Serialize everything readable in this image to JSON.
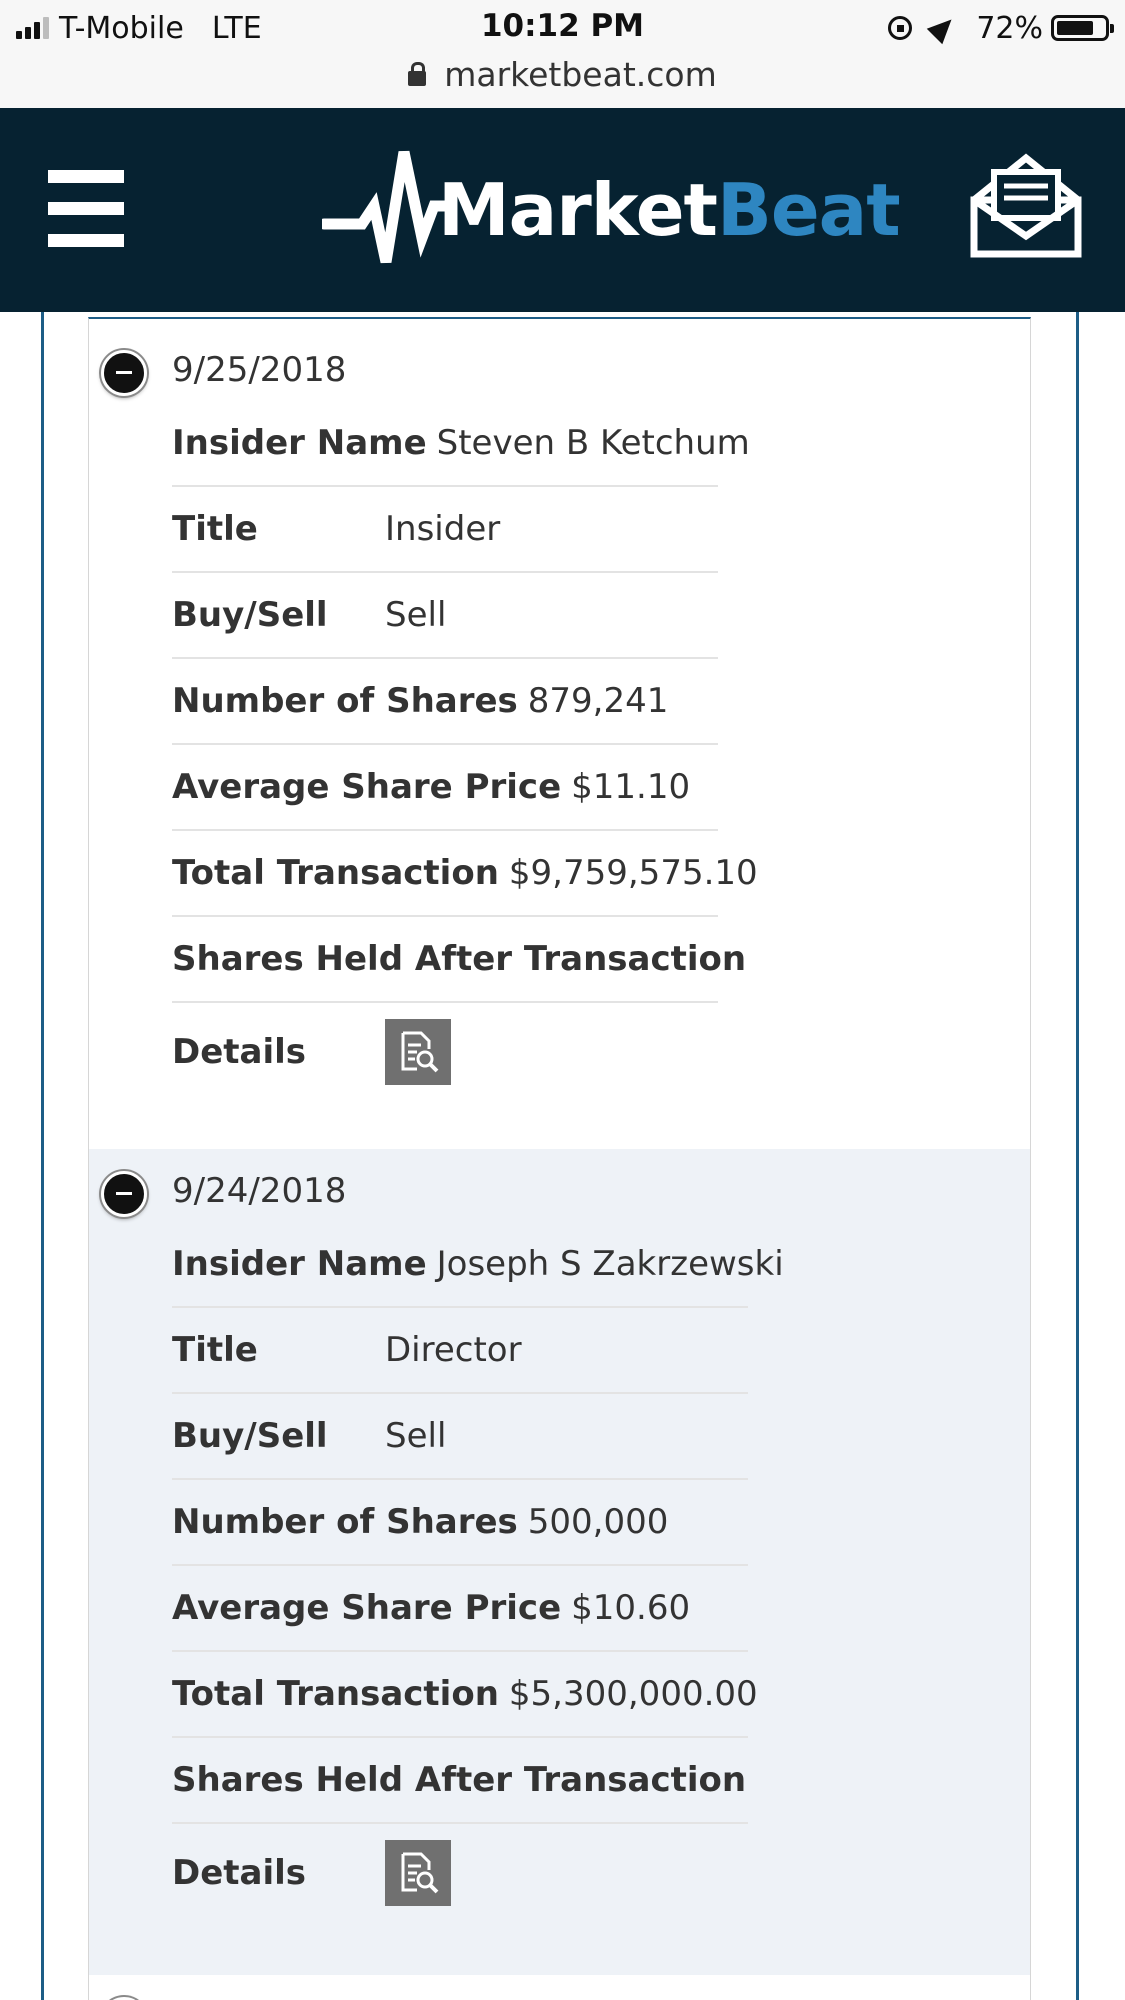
{
  "status_bar": {
    "carrier": "T-Mobile",
    "network": "LTE",
    "time": "10:12 PM",
    "battery": "72%",
    "battery_level": 0.72
  },
  "url_bar": {
    "domain": "marketbeat.com"
  },
  "header": {
    "logo_market": "Market",
    "logo_beat": "Beat",
    "colors": {
      "background": "#062231",
      "brand_blue": "#2e86c1",
      "frame_blue": "#1d5d86"
    },
    "menu_icon": "hamburger-menu-icon",
    "mail_icon": "envelope-icon"
  },
  "transactions": [
    {
      "date": "9/25/2018",
      "insider_name_label": "Insider Name",
      "insider_name": "Steven B Ketchum",
      "title_label": "Title",
      "title": "Insider",
      "buy_sell_label": "Buy/Sell",
      "buy_sell": "Sell",
      "shares_label": "Number of Shares",
      "shares": "879,241",
      "avg_price_label": "Average Share Price",
      "avg_price": "$11.10",
      "total_label": "Total Transaction",
      "total": "$9,759,575.10",
      "held_after_label": "Shares Held After Transaction",
      "held_after": "",
      "details_label": "Details",
      "details_icon": "document-search-icon"
    },
    {
      "date": "9/24/2018",
      "insider_name_label": "Insider Name",
      "insider_name": "Joseph S Zakrzewski",
      "title_label": "Title",
      "title": "Director",
      "buy_sell_label": "Buy/Sell",
      "buy_sell": "Sell",
      "shares_label": "Number of Shares",
      "shares": "500,000",
      "avg_price_label": "Average Share Price",
      "avg_price": "$10.60",
      "total_label": "Total Transaction",
      "total": "$5,300,000.00",
      "held_after_label": "Shares Held After Transaction",
      "held_after": "",
      "details_label": "Details",
      "details_icon": "document-search-icon"
    }
  ]
}
